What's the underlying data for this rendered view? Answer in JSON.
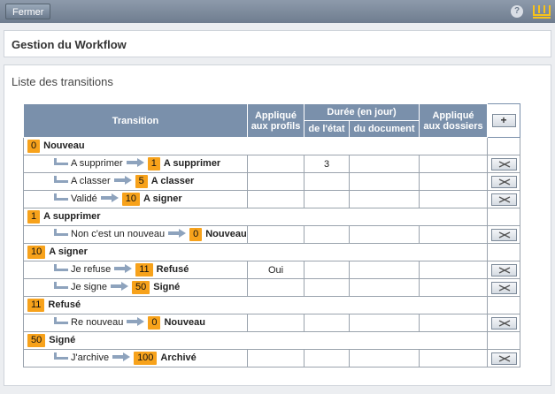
{
  "topbar": {
    "close_label": "Fermer",
    "help_label": "?"
  },
  "header": {
    "title": "Gestion du Workflow"
  },
  "main": {
    "title": "Liste des transitions"
  },
  "table": {
    "headers": {
      "transition": "Transition",
      "applied_profiles_1": "Appliqué",
      "applied_profiles_2": "aux profils",
      "duration": "Durée (en jour)",
      "of_state": "de l'état",
      "of_document": "du document",
      "applied_folders_1": "Appliqué",
      "applied_folders_2": "aux dossiers",
      "add": "+"
    },
    "states": [
      {
        "num": "0",
        "name": "Nouveau",
        "transitions": [
          {
            "label": "A supprimer",
            "target_num": "1",
            "target_name": "A supprimer",
            "profiles": "",
            "state_days": "3",
            "doc_days": "",
            "folders": ""
          },
          {
            "label": "A classer",
            "target_num": "5",
            "target_name": "A classer",
            "profiles": "",
            "state_days": "",
            "doc_days": "",
            "folders": ""
          },
          {
            "label": "Validé",
            "target_num": "10",
            "target_name": "A signer",
            "profiles": "",
            "state_days": "",
            "doc_days": "",
            "folders": ""
          }
        ]
      },
      {
        "num": "1",
        "name": "A supprimer",
        "transitions": [
          {
            "label": "Non c'est un nouveau",
            "target_num": "0",
            "target_name": "Nouveau",
            "profiles": "",
            "state_days": "",
            "doc_days": "",
            "folders": ""
          }
        ]
      },
      {
        "num": "10",
        "name": "A signer",
        "transitions": [
          {
            "label": "Je refuse",
            "target_num": "11",
            "target_name": "Refusé",
            "profiles": "Oui",
            "state_days": "",
            "doc_days": "",
            "folders": ""
          },
          {
            "label": "Je signe",
            "target_num": "50",
            "target_name": "Signé",
            "profiles": "",
            "state_days": "",
            "doc_days": "",
            "folders": ""
          }
        ]
      },
      {
        "num": "11",
        "name": "Refusé",
        "transitions": [
          {
            "label": "Re nouveau",
            "target_num": "0",
            "target_name": "Nouveau",
            "profiles": "",
            "state_days": "",
            "doc_days": "",
            "folders": ""
          }
        ]
      },
      {
        "num": "50",
        "name": "Signé",
        "transitions": [
          {
            "label": "J'archive",
            "target_num": "100",
            "target_name": "Archivé",
            "profiles": "",
            "state_days": "",
            "doc_days": "",
            "folders": ""
          }
        ]
      }
    ]
  },
  "icons": {
    "logo": "w-logo-icon",
    "help": "help-icon",
    "delete": "delete-icon",
    "add": "add-icon",
    "branch": "branch-icon",
    "arrow": "arrow-right-icon"
  },
  "colors": {
    "accent": "#7a90ab",
    "badge": "#f7a21b",
    "topbar": "#7d8b9d"
  }
}
